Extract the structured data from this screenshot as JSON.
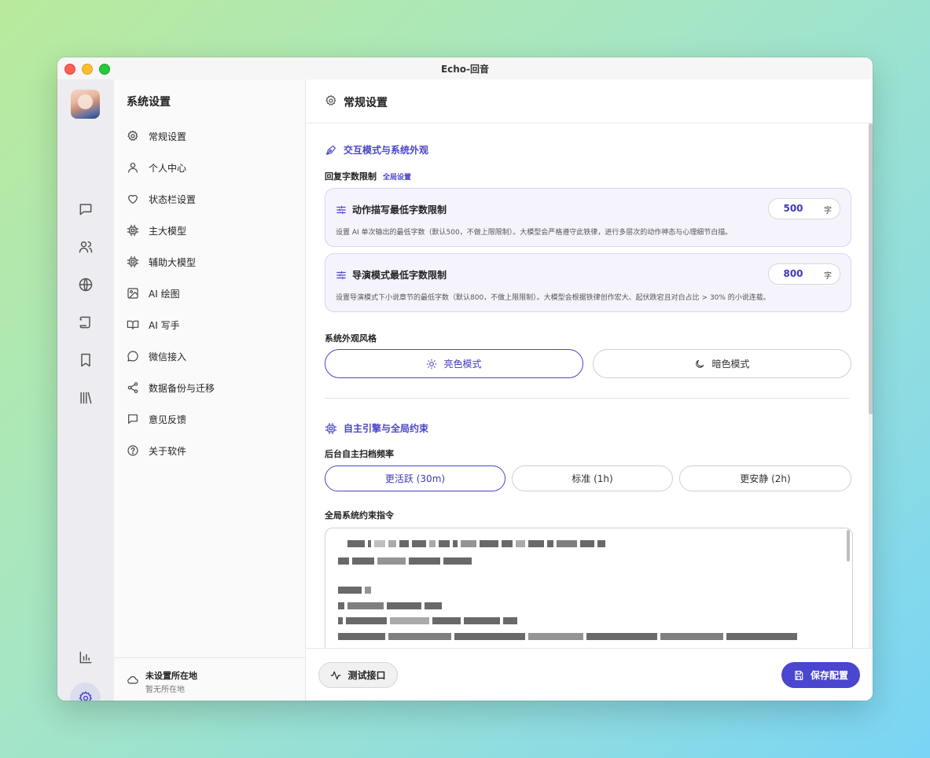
{
  "window": {
    "title": "Echo-回音"
  },
  "nav": {
    "title": "系统设置",
    "items": [
      {
        "label": "常规设置",
        "icon": "gear-icon"
      },
      {
        "label": "个人中心",
        "icon": "user-icon"
      },
      {
        "label": "状态栏设置",
        "icon": "heart-icon"
      },
      {
        "label": "主大模型",
        "icon": "chip-icon"
      },
      {
        "label": "辅助大模型",
        "icon": "chip-icon"
      },
      {
        "label": "AI 绘图",
        "icon": "image-icon"
      },
      {
        "label": "AI 写手",
        "icon": "book-icon"
      },
      {
        "label": "微信接入",
        "icon": "message-icon"
      },
      {
        "label": "数据备份与迁移",
        "icon": "share-icon"
      },
      {
        "label": "意见反馈",
        "icon": "feedback-icon"
      },
      {
        "label": "关于软件",
        "icon": "help-icon"
      }
    ],
    "location": {
      "main": "未设置所在地",
      "sub": "暂无所在地"
    }
  },
  "main": {
    "title": "常规设置",
    "section1": {
      "title": "交互模式与系统外观",
      "word_limit_label": "回复字数限制",
      "word_limit_tag": "全局设置",
      "cards": [
        {
          "title": "动作描写最低字数限制",
          "value": "500",
          "unit": "字",
          "desc": "设置 AI 单次输出的最低字数（默认500，不做上限限制）。大模型会严格遵守此铁律，进行多层次的动作神态与心理细节白描。"
        },
        {
          "title": "导演模式最低字数限制",
          "value": "800",
          "unit": "字",
          "desc": "设置导演模式下小说章节的最低字数（默认800，不做上限限制）。大模型会根据铁律创作宏大、起伏跌宕且对白占比 > 30% 的小说连载。"
        }
      ],
      "theme_label": "系统外观风格",
      "theme_light": "亮色模式",
      "theme_dark": "暗色模式"
    },
    "section2": {
      "title": "自主引擎与全局约束",
      "freq_label": "后台自主扫档频率",
      "freq_options": [
        "更活跃 (30m)",
        "标准 (1h)",
        "更安静 (2h)"
      ],
      "constraint_label": "全局系统约束指令"
    },
    "footer": {
      "test_label": "测试接口",
      "save_label": "保存配置"
    }
  },
  "colors": {
    "accent": "#4a46c8",
    "card_bg": "#f5f4fd",
    "save_button": "#4a46d0"
  }
}
